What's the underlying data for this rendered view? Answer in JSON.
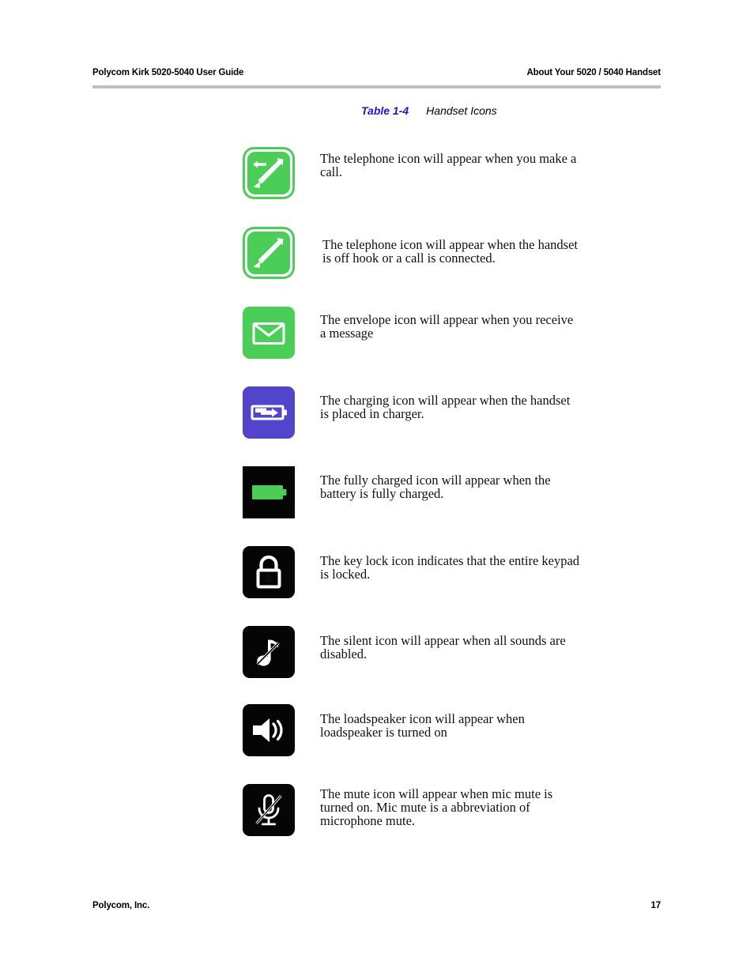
{
  "header": {
    "left": "Polycom Kirk 5020-5040 User Guide",
    "right": "About Your 5020 / 5040 Handset"
  },
  "caption": {
    "label": "Table 1-4",
    "title": "Handset Icons"
  },
  "colors": {
    "green": "#4ace58",
    "purple": "#5344cc",
    "black": "#050505",
    "white": "#ffffff",
    "caption_blue": "#1a18d6",
    "rule_gray": "#bfbfbf"
  },
  "rows": [
    {
      "icon": "outgoing-call-icon",
      "tile_color": "#4ace58",
      "text": "The telephone icon will appear when you make a call."
    },
    {
      "icon": "offhook-call-icon",
      "tile_color": "#4ace58",
      "text": "The telephone icon will appear when the handset is off hook or a call is connected."
    },
    {
      "icon": "envelope-icon",
      "tile_color": "#4ace58",
      "text": "The envelope icon will appear when you receive a message"
    },
    {
      "icon": "charging-battery-icon",
      "tile_color": "#5344cc",
      "text": "The charging icon will appear when the handset is placed in charger."
    },
    {
      "icon": "full-battery-icon",
      "tile_color": "#050505",
      "text": "The fully charged icon will appear when the battery is fully charged."
    },
    {
      "icon": "key-lock-icon",
      "tile_color": "#050505",
      "text": "The key lock icon indicates that the entire keypad is locked."
    },
    {
      "icon": "silent-note-icon",
      "tile_color": "#050505",
      "text": "The silent icon will appear when all sounds are disabled."
    },
    {
      "icon": "loudspeaker-icon",
      "tile_color": "#050505",
      "text": "The loadspeaker icon will appear when loadspeaker is turned on"
    },
    {
      "icon": "mic-mute-icon",
      "tile_color": "#050505",
      "text": "The mute icon will appear when mic mute is turned on. Mic mute is a abbreviation of microphone mute."
    }
  ],
  "footer": {
    "left": "Polycom, Inc.",
    "page_number": "17"
  }
}
